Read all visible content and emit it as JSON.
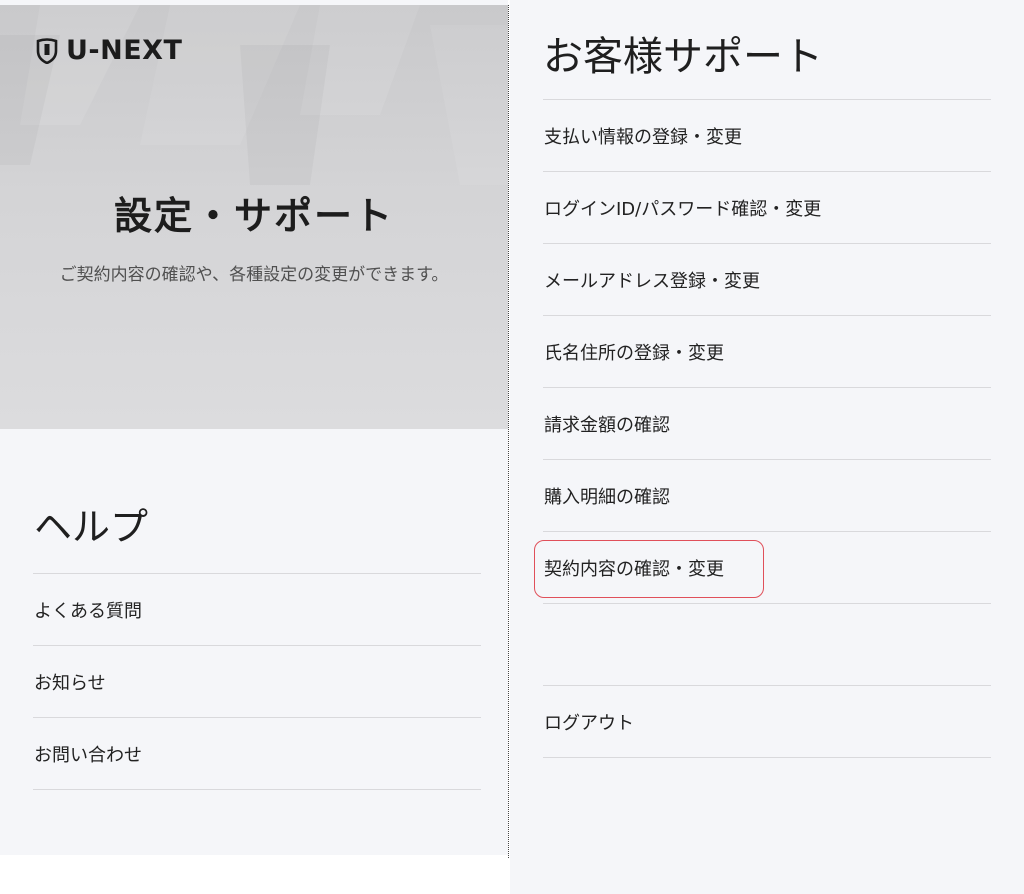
{
  "left": {
    "logo_text": "U-NEXT",
    "hero_title": "設定・サポート",
    "hero_subtitle": "ご契約内容の確認や、各種設定の変更ができます。",
    "help_title": "ヘルプ",
    "help_items": [
      {
        "label": "よくある質問"
      },
      {
        "label": "お知らせ"
      },
      {
        "label": "お問い合わせ"
      }
    ]
  },
  "right": {
    "title": "お客様サポート",
    "items": [
      {
        "label": "支払い情報の登録・変更"
      },
      {
        "label": "ログインID/パスワード確認・変更"
      },
      {
        "label": "メールアドレス登録・変更"
      },
      {
        "label": "氏名住所の登録・変更"
      },
      {
        "label": "請求金額の確認"
      },
      {
        "label": "購入明細の確認"
      },
      {
        "label": "契約内容の確認・変更"
      }
    ],
    "logout_label": "ログアウト"
  },
  "colors": {
    "background": "#f5f6f9",
    "divider": "#d9d9dc",
    "highlight": "#e0505a"
  }
}
